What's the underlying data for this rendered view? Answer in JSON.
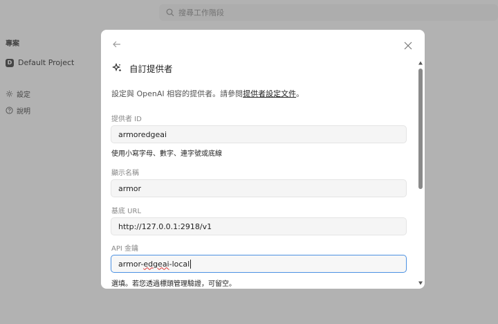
{
  "search": {
    "placeholder": "搜尋工作階段"
  },
  "sidebar": {
    "heading": "專案",
    "project": {
      "badge": "D",
      "name": "Default Project"
    },
    "items": [
      {
        "label": "設定",
        "icon": "gear-icon"
      },
      {
        "label": "說明",
        "icon": "help-circle-icon"
      }
    ]
  },
  "modal": {
    "title": "自訂提供者",
    "title_icon": "sparkles-icon",
    "description": "設定與 OpenAI 相容的提供者。請參閱",
    "description_link": "提供者設定文件",
    "description_end": "。",
    "fields": {
      "provider_id": {
        "label": "提供者 ID",
        "value": "armoredgeai",
        "hint": "使用小寫字母、數字、連字號或底線"
      },
      "display_name": {
        "label": "顯示名稱",
        "value": "armor"
      },
      "base_url": {
        "label": "基底 URL",
        "value": "http://127.0.0.1:2918/v1"
      },
      "api_key": {
        "label": "API 金鑰",
        "value_prefix": "armor-",
        "value_spell": "edgeai",
        "value_suffix": "-local",
        "hint": "選填。若您透過標頭管理驗證，可留空。"
      }
    }
  },
  "colors": {
    "overlay": "#5a5a5a",
    "focus": "#4a90e2",
    "scroll_thumb": "#8a8a8a"
  }
}
